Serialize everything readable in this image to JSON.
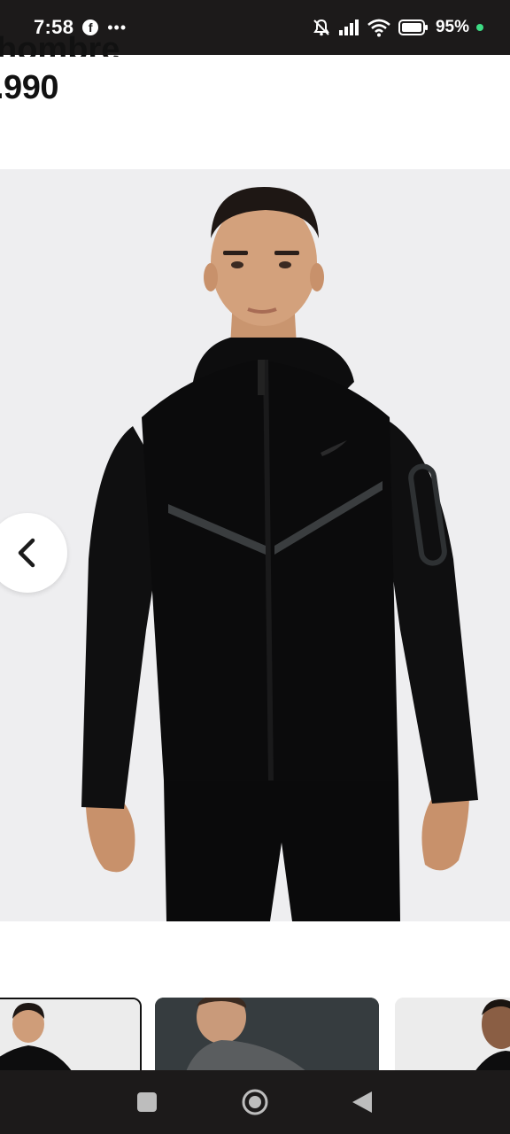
{
  "status_bar": {
    "time": "7:58",
    "notification_icons": [
      "facebook-icon",
      "more-dots-icon"
    ],
    "system_icons": [
      "mute-icon",
      "signal-icon",
      "wifi-icon",
      "battery-icon"
    ],
    "battery_percent": "95%",
    "indicator_color": "#3ddc84"
  },
  "product": {
    "title_fragment": "hombre",
    "price_fragment": ".990",
    "image_alt": "Black full-zip hoodie worn by model"
  },
  "gallery": {
    "prev_icon": "chevron-left-icon",
    "thumbnails": [
      {
        "name": "thumbnail-1",
        "selected": true
      },
      {
        "name": "thumbnail-2",
        "selected": false
      },
      {
        "name": "thumbnail-3",
        "selected": false
      }
    ]
  },
  "nav_bar": {
    "buttons": [
      "recents-button",
      "home-button",
      "back-button"
    ]
  }
}
